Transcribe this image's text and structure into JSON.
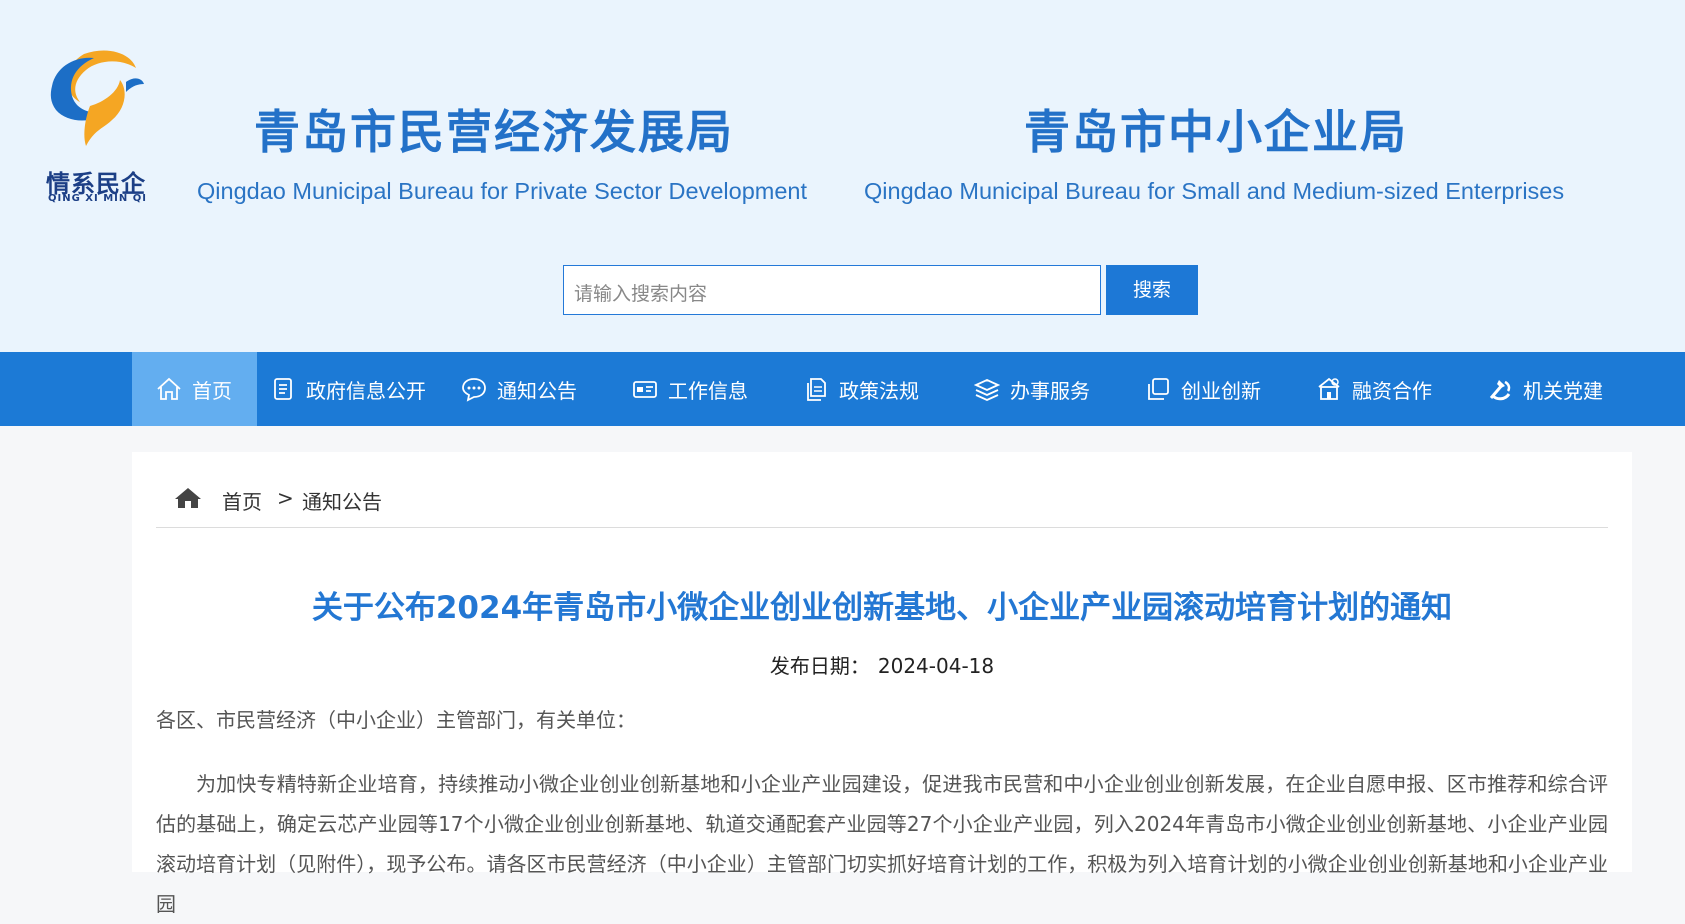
{
  "header": {
    "logo": {
      "text_cn": "情系民企",
      "text_en": "QING XI MIN QI",
      "colors": {
        "orange": "#f5a623",
        "blue": "#1c6ec6"
      }
    },
    "bureaus": [
      {
        "cn": "青岛市民营经济发展局",
        "en": "Qingdao Municipal Bureau for Private Sector Development"
      },
      {
        "cn": "青岛市中小企业局",
        "en": "Qingdao Municipal Bureau for Small and Medium-sized Enterprises"
      }
    ],
    "search": {
      "placeholder": "请输入搜索内容",
      "button": "搜索"
    }
  },
  "nav": {
    "items": [
      {
        "label": "首页",
        "icon": "home-icon",
        "active": true
      },
      {
        "label": "政府信息公开",
        "icon": "document-list-icon"
      },
      {
        "label": "通知公告",
        "icon": "chat-bubble-icon"
      },
      {
        "label": "工作信息",
        "icon": "id-card-icon"
      },
      {
        "label": "政策法规",
        "icon": "file-copy-icon"
      },
      {
        "label": "办事服务",
        "icon": "layers-icon"
      },
      {
        "label": "创业创新",
        "icon": "square-copy-icon"
      },
      {
        "label": "融资合作",
        "icon": "building-icon"
      },
      {
        "label": "机关党建",
        "icon": "party-emblem-icon"
      }
    ]
  },
  "breadcrumb": {
    "home": "首页",
    "separator": ">",
    "current": "通知公告"
  },
  "article": {
    "title": "关于公布2024年青岛市小微企业创业创新基地、小企业产业园滚动培育计划的通知",
    "date_label": "发布日期：",
    "date": "2024-04-18",
    "salutation": "各区、市民营经济（中小企业）主管部门，有关单位：",
    "body": "为加快专精特新企业培育，持续推动小微企业创业创新基地和小企业产业园建设，促进我市民营和中小企业创业创新发展，在企业自愿申报、区市推荐和综合评估的基础上，确定云芯产业园等17个小微企业创业创新基地、轨道交通配套产业园等27个小企业产业园，列入2024年青岛市小微企业创业创新基地、小企业产业园滚动培育计划（见附件），现予公布。请各区市民营经济（中小企业）主管部门切实抓好培育计划的工作，积极为列入培育计划的小微企业创业创新基地和小企业产业园"
  },
  "colors": {
    "nav_bg": "#1c7ad6",
    "nav_active": "#63aef0",
    "title": "#2377d3",
    "header_bg": "#eaf4fd"
  }
}
